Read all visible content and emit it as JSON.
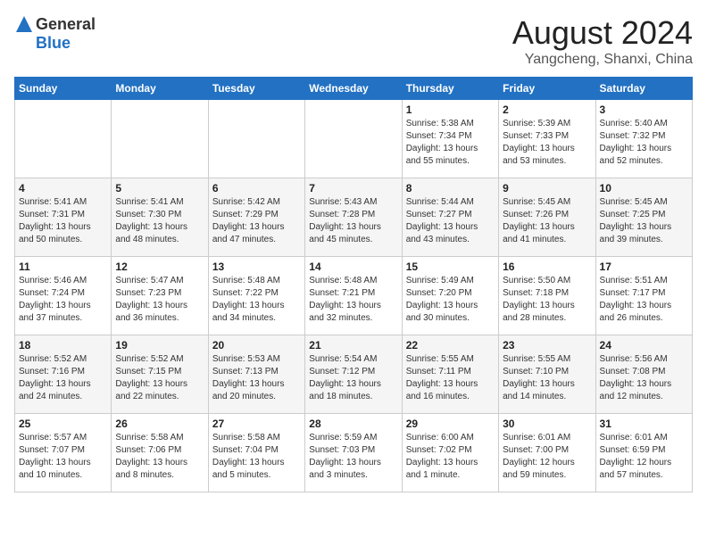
{
  "header": {
    "logo_general": "General",
    "logo_blue": "Blue",
    "month_title": "August 2024",
    "location": "Yangcheng, Shanxi, China"
  },
  "days_of_week": [
    "Sunday",
    "Monday",
    "Tuesday",
    "Wednesday",
    "Thursday",
    "Friday",
    "Saturday"
  ],
  "weeks": [
    [
      {
        "day": "",
        "info": ""
      },
      {
        "day": "",
        "info": ""
      },
      {
        "day": "",
        "info": ""
      },
      {
        "day": "",
        "info": ""
      },
      {
        "day": "1",
        "info": "Sunrise: 5:38 AM\nSunset: 7:34 PM\nDaylight: 13 hours\nand 55 minutes."
      },
      {
        "day": "2",
        "info": "Sunrise: 5:39 AM\nSunset: 7:33 PM\nDaylight: 13 hours\nand 53 minutes."
      },
      {
        "day": "3",
        "info": "Sunrise: 5:40 AM\nSunset: 7:32 PM\nDaylight: 13 hours\nand 52 minutes."
      }
    ],
    [
      {
        "day": "4",
        "info": "Sunrise: 5:41 AM\nSunset: 7:31 PM\nDaylight: 13 hours\nand 50 minutes."
      },
      {
        "day": "5",
        "info": "Sunrise: 5:41 AM\nSunset: 7:30 PM\nDaylight: 13 hours\nand 48 minutes."
      },
      {
        "day": "6",
        "info": "Sunrise: 5:42 AM\nSunset: 7:29 PM\nDaylight: 13 hours\nand 47 minutes."
      },
      {
        "day": "7",
        "info": "Sunrise: 5:43 AM\nSunset: 7:28 PM\nDaylight: 13 hours\nand 45 minutes."
      },
      {
        "day": "8",
        "info": "Sunrise: 5:44 AM\nSunset: 7:27 PM\nDaylight: 13 hours\nand 43 minutes."
      },
      {
        "day": "9",
        "info": "Sunrise: 5:45 AM\nSunset: 7:26 PM\nDaylight: 13 hours\nand 41 minutes."
      },
      {
        "day": "10",
        "info": "Sunrise: 5:45 AM\nSunset: 7:25 PM\nDaylight: 13 hours\nand 39 minutes."
      }
    ],
    [
      {
        "day": "11",
        "info": "Sunrise: 5:46 AM\nSunset: 7:24 PM\nDaylight: 13 hours\nand 37 minutes."
      },
      {
        "day": "12",
        "info": "Sunrise: 5:47 AM\nSunset: 7:23 PM\nDaylight: 13 hours\nand 36 minutes."
      },
      {
        "day": "13",
        "info": "Sunrise: 5:48 AM\nSunset: 7:22 PM\nDaylight: 13 hours\nand 34 minutes."
      },
      {
        "day": "14",
        "info": "Sunrise: 5:48 AM\nSunset: 7:21 PM\nDaylight: 13 hours\nand 32 minutes."
      },
      {
        "day": "15",
        "info": "Sunrise: 5:49 AM\nSunset: 7:20 PM\nDaylight: 13 hours\nand 30 minutes."
      },
      {
        "day": "16",
        "info": "Sunrise: 5:50 AM\nSunset: 7:18 PM\nDaylight: 13 hours\nand 28 minutes."
      },
      {
        "day": "17",
        "info": "Sunrise: 5:51 AM\nSunset: 7:17 PM\nDaylight: 13 hours\nand 26 minutes."
      }
    ],
    [
      {
        "day": "18",
        "info": "Sunrise: 5:52 AM\nSunset: 7:16 PM\nDaylight: 13 hours\nand 24 minutes."
      },
      {
        "day": "19",
        "info": "Sunrise: 5:52 AM\nSunset: 7:15 PM\nDaylight: 13 hours\nand 22 minutes."
      },
      {
        "day": "20",
        "info": "Sunrise: 5:53 AM\nSunset: 7:13 PM\nDaylight: 13 hours\nand 20 minutes."
      },
      {
        "day": "21",
        "info": "Sunrise: 5:54 AM\nSunset: 7:12 PM\nDaylight: 13 hours\nand 18 minutes."
      },
      {
        "day": "22",
        "info": "Sunrise: 5:55 AM\nSunset: 7:11 PM\nDaylight: 13 hours\nand 16 minutes."
      },
      {
        "day": "23",
        "info": "Sunrise: 5:55 AM\nSunset: 7:10 PM\nDaylight: 13 hours\nand 14 minutes."
      },
      {
        "day": "24",
        "info": "Sunrise: 5:56 AM\nSunset: 7:08 PM\nDaylight: 13 hours\nand 12 minutes."
      }
    ],
    [
      {
        "day": "25",
        "info": "Sunrise: 5:57 AM\nSunset: 7:07 PM\nDaylight: 13 hours\nand 10 minutes."
      },
      {
        "day": "26",
        "info": "Sunrise: 5:58 AM\nSunset: 7:06 PM\nDaylight: 13 hours\nand 8 minutes."
      },
      {
        "day": "27",
        "info": "Sunrise: 5:58 AM\nSunset: 7:04 PM\nDaylight: 13 hours\nand 5 minutes."
      },
      {
        "day": "28",
        "info": "Sunrise: 5:59 AM\nSunset: 7:03 PM\nDaylight: 13 hours\nand 3 minutes."
      },
      {
        "day": "29",
        "info": "Sunrise: 6:00 AM\nSunset: 7:02 PM\nDaylight: 13 hours\nand 1 minute."
      },
      {
        "day": "30",
        "info": "Sunrise: 6:01 AM\nSunset: 7:00 PM\nDaylight: 12 hours\nand 59 minutes."
      },
      {
        "day": "31",
        "info": "Sunrise: 6:01 AM\nSunset: 6:59 PM\nDaylight: 12 hours\nand 57 minutes."
      }
    ]
  ]
}
